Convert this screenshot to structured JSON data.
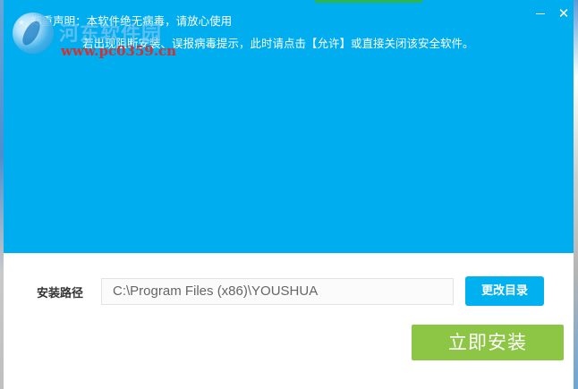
{
  "colors": {
    "banner": "#00adef",
    "accent_button": "#00b0ef",
    "install_button": "#8dc544",
    "watermark_url": "#d33030"
  },
  "header": {
    "notice": "郑重声明：本软件绝无病毒，请放心使用",
    "notice_hint": "若出现阻断安装、误报病毒提示，此时请点击【允许】或直接关闭该安全软件。",
    "minimize_icon": "minimize-icon",
    "close_icon": "close-icon",
    "close_glyph": "✕"
  },
  "watermark": {
    "site_name": "河东软件园",
    "url": "www.pc0359.cn"
  },
  "install": {
    "path_label": "安装路径",
    "path_value": "C:\\Program Files (x86)\\YOUSHUA",
    "change_dir_label": "更改目录",
    "install_now_label": "立即安装"
  }
}
